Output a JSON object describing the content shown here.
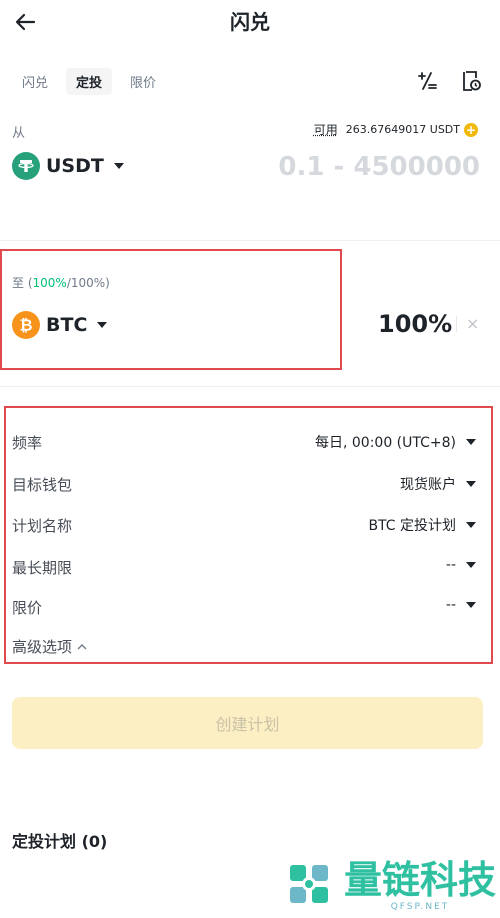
{
  "header": {
    "title": "闪兑"
  },
  "tabs": [
    {
      "label": "闪兑",
      "active": false
    },
    {
      "label": "定投",
      "active": true
    },
    {
      "label": "限价",
      "active": false
    }
  ],
  "from": {
    "label": "从",
    "available_label": "可用",
    "available_value": "263.67649017 USDT",
    "coin": "USDT",
    "amount_placeholder": "0.1 - 4500000"
  },
  "to": {
    "label_prefix": "至 (",
    "label_pct": "100%",
    "label_suffix": "/100%)",
    "coin": "BTC",
    "percentage": "100%",
    "close_symbol": "×"
  },
  "settings": {
    "frequency": {
      "label": "频率",
      "value": "每日, 00:00 (UTC+8)"
    },
    "wallet": {
      "label": "目标钱包",
      "value": "现货账户"
    },
    "plan_name": {
      "label": "计划名称",
      "value": "BTC 定投计划"
    },
    "max_period": {
      "label": "最长期限",
      "value": "--"
    },
    "limit_price": {
      "label": "限价",
      "value": "--"
    },
    "advanced": "高级选项"
  },
  "create_button": "创建计划",
  "plans_title": "定投计划 (0)",
  "watermark": {
    "title": "量链科技",
    "sub": "QFSP.NET"
  },
  "colors": {
    "accent": "#f0b90b",
    "usdt": "#26a17b",
    "btc": "#f7931a",
    "highlight_border": "#e04a4f",
    "green": "#02c076"
  }
}
